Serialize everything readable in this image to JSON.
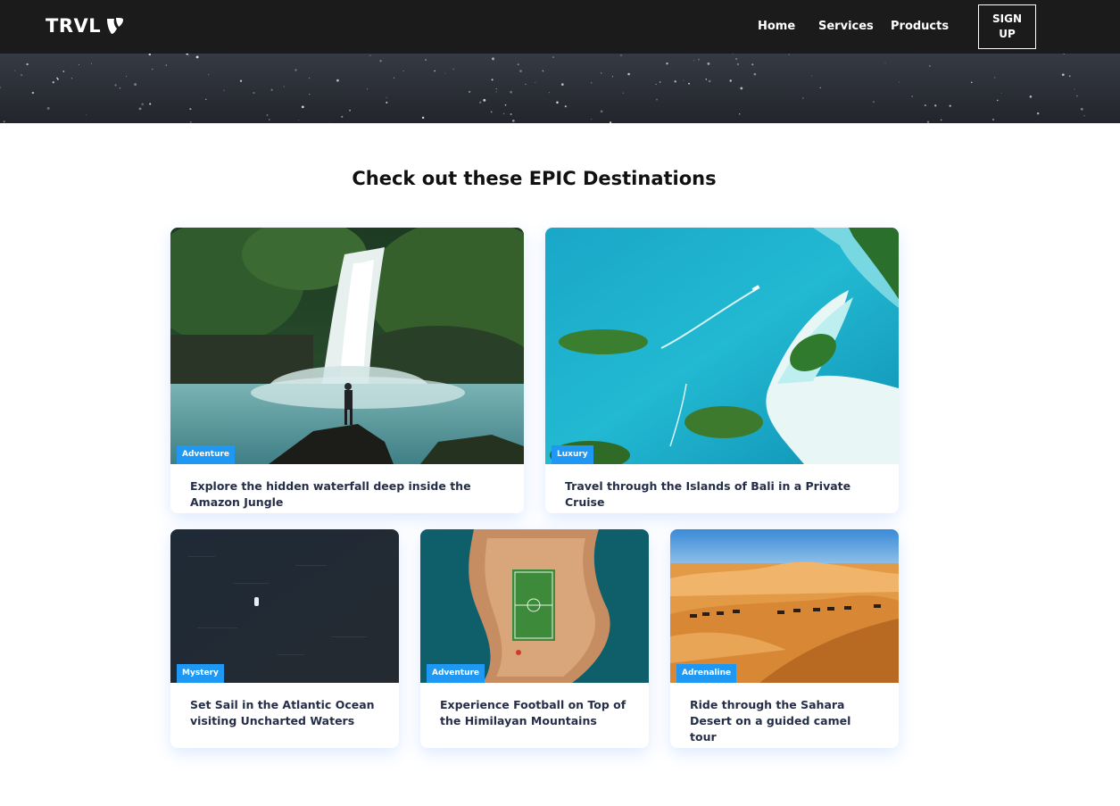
{
  "navbar": {
    "logo_text": "TRVL",
    "logo_icon": "typo3-logo-icon",
    "links": [
      {
        "label": "Home"
      },
      {
        "label": "Services"
      },
      {
        "label": "Products"
      }
    ],
    "signup_label": "SIGN UP"
  },
  "section": {
    "title": "Check out these EPIC Destinations"
  },
  "cards": [
    {
      "badge": "Adventure",
      "text": "Explore the hidden waterfall deep inside the Amazon Jungle",
      "image": "waterfall-jungle"
    },
    {
      "badge": "Luxury",
      "text": "Travel through the Islands of Bali in a Private Cruise",
      "image": "aerial-islands-lagoon"
    },
    {
      "badge": "Mystery",
      "text": "Set Sail in the Atlantic Ocean visiting Uncharted Waters",
      "image": "dark-ocean-boat"
    },
    {
      "badge": "Adventure",
      "text": "Experience Football on Top of the Himilayan Mountains",
      "image": "football-pitch-rocky-island"
    },
    {
      "badge": "Adrenaline",
      "text": "Ride through the Sahara Desert on a guided camel tour",
      "image": "desert-dunes-camels"
    }
  ],
  "colors": {
    "navbar_bg": "#1c1b1b",
    "badge_bg": "#1f98f4",
    "card_text": "#252e48"
  }
}
